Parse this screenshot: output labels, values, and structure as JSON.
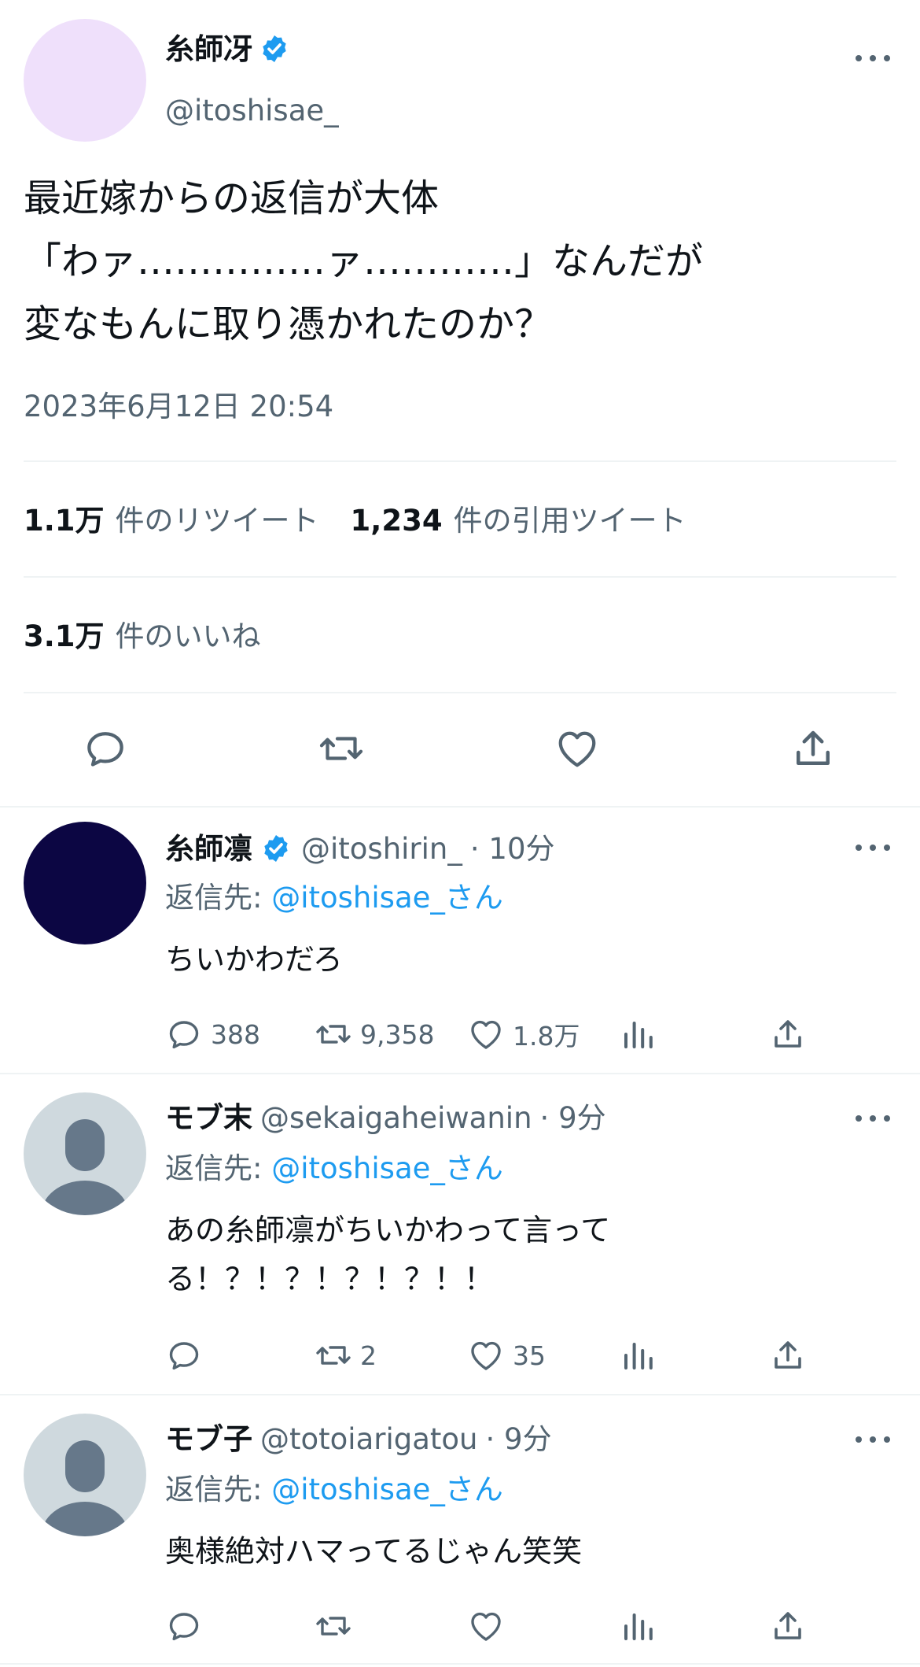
{
  "main_tweet": {
    "name": "糸師冴",
    "handle": "@itoshisae_",
    "text_lines": [
      "最近嫁からの返信が大体",
      "「わァ……………ァ…………」なんだが",
      "変なもんに取り憑かれたのか？"
    ],
    "timestamp": "2023年6月12日 20:54",
    "retweets_count": "1.1万",
    "retweets_label": "件のリツイート",
    "quotes_count": "1,234",
    "quotes_label": "件の引用ツイート",
    "likes_count": "3.1万",
    "likes_label": "件のいいね",
    "avatar_color": "#efe0fb"
  },
  "replies": [
    {
      "name": "糸師凛",
      "verified": true,
      "handle": "@itoshirin_",
      "time": "· 10分",
      "reply_to_label": "返信先: ",
      "reply_to_handle": "@itoshisae_さん",
      "text_lines": [
        "ちいかわだろ"
      ],
      "reply_count": "388",
      "retweet_count": "9,358",
      "like_count": "1.8万",
      "avatar_color": "#0c0643"
    },
    {
      "name": "モブ末",
      "verified": false,
      "handle": "@sekaigaheiwanin",
      "time": "· 9分",
      "reply_to_label": "返信先: ",
      "reply_to_handle": "@itoshisae_さん",
      "text_lines": [
        "あの糸師凛がちいかわって言って",
        "る！？！？！？！？！！"
      ],
      "reply_count": "",
      "retweet_count": "2",
      "like_count": "35",
      "avatar_color": "#cfd9de"
    },
    {
      "name": "モブ子",
      "verified": false,
      "handle": "@totoiarigatou",
      "time": "· 9分",
      "reply_to_label": "返信先: ",
      "reply_to_handle": "@itoshisae_さん",
      "text_lines": [
        "奥様絶対ハマってるじゃん笑笑"
      ],
      "reply_count": "",
      "retweet_count": "",
      "like_count": "",
      "avatar_color": "#cfd9de"
    }
  ],
  "icons": {
    "verified": "verified-badge-icon",
    "reply": "reply-bubble-icon",
    "retweet": "retweet-icon",
    "like": "heart-icon",
    "views": "views-bar-chart-icon",
    "share": "share-icon",
    "more": "more-dots-icon"
  },
  "colors": {
    "accent": "#1d9bf0",
    "text": "#0f1419",
    "secondary": "#536471",
    "divider": "#eff3f4"
  }
}
